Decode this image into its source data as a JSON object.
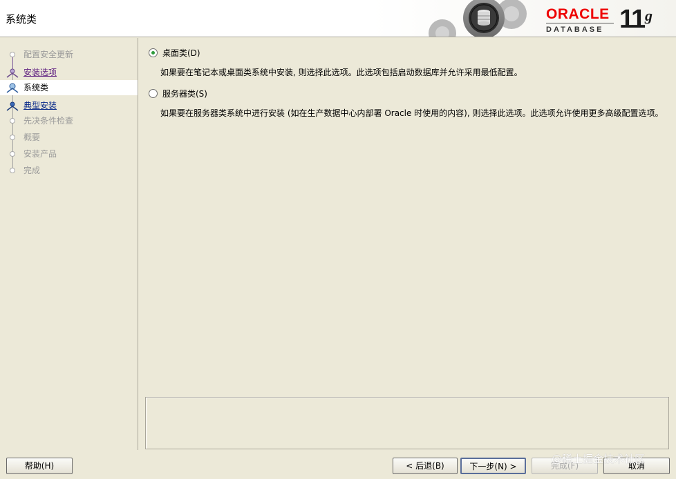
{
  "header": {
    "title": "系统类",
    "brand": "ORACLE",
    "product": "DATABASE",
    "version": "11",
    "version_suffix": "g",
    "brand_color": "#ee0000"
  },
  "sidebar": {
    "steps": [
      {
        "label": "配置安全更新",
        "state": "disabled"
      },
      {
        "label": "安装选项",
        "state": "visited"
      },
      {
        "label": "系统类",
        "state": "current"
      },
      {
        "label": "典型安装",
        "state": "link"
      },
      {
        "label": "先决条件检查",
        "state": "disabled"
      },
      {
        "label": "概要",
        "state": "disabled"
      },
      {
        "label": "安装产品",
        "state": "disabled"
      },
      {
        "label": "完成",
        "state": "disabled"
      }
    ]
  },
  "main": {
    "desktop": {
      "label": "桌面类(D)",
      "checked": true,
      "description": "如果要在笔记本或桌面类系统中安装, 则选择此选项。此选项包括启动数据库并允许采用最低配置。"
    },
    "server": {
      "label": "服务器类(S)",
      "checked": false,
      "description": "如果要在服务器类系统中进行安装 (如在生产数据中心内部署 Oracle 时使用的内容), 则选择此选项。此选项允许使用更多高级配置选项。"
    }
  },
  "footer": {
    "help": "帮助(H)",
    "back": "< 后退(B)",
    "next": "下一步(N) >",
    "finish": "完成(F)",
    "cancel": "取消",
    "watermark": "@稀土掘金技术社区"
  }
}
